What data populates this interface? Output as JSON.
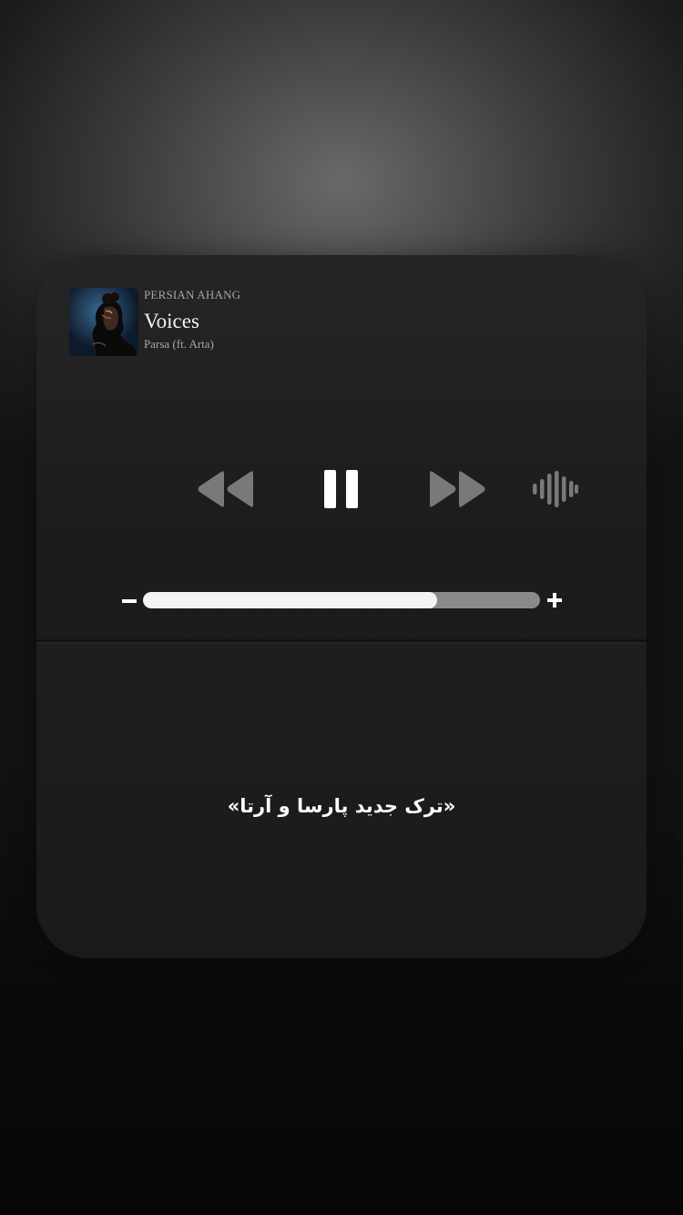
{
  "player": {
    "source": "PERSIAN AHANG",
    "title": "Voices",
    "artist": "Parsa (ft. Arta)",
    "artwork_icon": "album-artwork"
  },
  "controls": {
    "rewind_icon": "rewind-icon",
    "pause_icon": "pause-icon",
    "forward_icon": "fast-forward-icon",
    "waveform_icon": "waveform-icon"
  },
  "volume": {
    "level_fraction": 0.74,
    "minus_icon": "volume-down-icon",
    "plus_icon": "volume-up-icon"
  },
  "caption": "«ترک جدید پارسا و آرتا»",
  "colors": {
    "card_background": "#1d1c1c",
    "volume_fill": "#f4f4f4",
    "volume_track": "#8b8a8a",
    "control_active": "#ffffff",
    "control_inactive": "#7a7979"
  }
}
